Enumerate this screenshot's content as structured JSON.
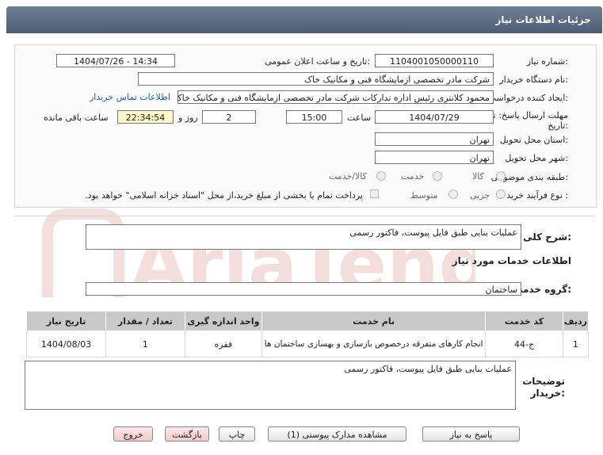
{
  "header": {
    "title": "جزئیات اطلاعات نیاز"
  },
  "form": {
    "need_number": {
      "label": "شماره نیاز:",
      "value": "1104001050000110"
    },
    "announce": {
      "label": "تاریخ و ساعت اعلان عمومی:",
      "value": "1404/07/26 - 14:34"
    },
    "buyer_org": {
      "label": "نام دستگاه خریدار:",
      "value": "شرکت مادر تخصصی ازمایشگاه فنی و مکانیک خاک"
    },
    "requester": {
      "label": "ایجاد کننده درخواست:",
      "value": "محمود کلانتری رئیس اداره تدارکات شرکت مادر تخصصی ازمایشگاه فنی و مکانیک خاک",
      "contact_link": "اطلاعات تماس خریدار"
    },
    "deadline": {
      "label_line1": "مهلت ارسال پاسخ: تا",
      "label_line2": "تاریخ:",
      "date": "1404/07/29",
      "time_label": "ساعت",
      "time": "15:00",
      "days": "2",
      "days_label": "روز و",
      "remaining": "22:34:54",
      "remaining_label": "ساعت باقی مانده"
    },
    "province": {
      "label": "استان محل تحویل:",
      "value": "تهران"
    },
    "city": {
      "label": "شهر محل تحویل:",
      "value": "تهران"
    },
    "category": {
      "label": "طبقه بندی موضوعی:",
      "options": [
        "کالا",
        "خدمت",
        "کالا/خدمت"
      ]
    },
    "process": {
      "label": "نوع فرآیند خرید :",
      "options": [
        "جزیی",
        "متوسط"
      ],
      "payment_note": "پرداخت تمام یا بخشی از مبلغ خرید،از محل \"اسناد خزانه اسلامی\" خواهد بود."
    }
  },
  "summary": {
    "label": "شرح کلی نیاز:",
    "value": "عملیات بنایی طبق فایل پیوست، فاکتور رسمی"
  },
  "services_info": {
    "title": "اطلاعات خدمات مورد نیاز"
  },
  "service_group": {
    "label": "گروه خدمت:",
    "value": "ساختمان"
  },
  "table": {
    "headers": [
      "ردیف",
      "کد خدمت",
      "نام خدمت",
      "واحد اندازه گیری",
      "تعداد / مقدار",
      "تاریخ نیاز"
    ],
    "rows": [
      [
        "1",
        "ج-44",
        "انجام کارهای متفرقه درخصوص بازسازی و بهسازی ساختمان ها",
        "فقره",
        "1",
        "1404/08/03"
      ]
    ]
  },
  "buyer_notes": {
    "label_line1": "توضیحات",
    "label_line2": "خریدار:",
    "value": "عملیات بنایی طبق فایل پیوست، فاکتور رسمی"
  },
  "buttons": {
    "reply": "پاسخ به نیاز",
    "docs": "مشاهده مدارک پیوستی (1)",
    "print": "چاپ",
    "back": "بازگشت",
    "exit": "خروج"
  },
  "watermark": {
    "text": "AriaTender.net",
    "color": "#c0392b"
  }
}
